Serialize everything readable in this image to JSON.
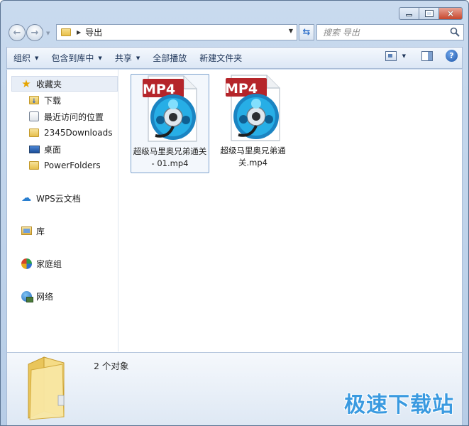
{
  "window": {
    "caption_buttons": {
      "minimize": "minimize",
      "maximize": "maximize",
      "close": "×"
    }
  },
  "address_bar": {
    "path": "导出",
    "icons": [
      "back-arrow-icon",
      "forward-arrow-icon",
      "folder-icon",
      "breadcrumb-separator-icon",
      "dropdown-icon",
      "refresh-icon"
    ]
  },
  "search": {
    "placeholder": "搜索 导出"
  },
  "toolbar": {
    "organize": "组织",
    "include_in_library": "包含到库中",
    "share": "共享",
    "play_all": "全部播放",
    "new_folder": "新建文件夹",
    "help": "?"
  },
  "sidebar": {
    "favorites": "收藏夹",
    "items": [
      {
        "label": "下载",
        "icon": "download-folder-icon"
      },
      {
        "label": "最近访问的位置",
        "icon": "recent-places-icon"
      },
      {
        "label": "2345Downloads",
        "icon": "folder-icon"
      },
      {
        "label": "桌面",
        "icon": "desktop-icon"
      },
      {
        "label": "PowerFolders",
        "icon": "folder-icon"
      }
    ],
    "wps_cloud": "WPS云文档",
    "libraries": "库",
    "homegroup": "家庭组",
    "network": "网络"
  },
  "files": [
    {
      "name": "超级马里奥兄弟通关 - 01.mp4",
      "badge": "MP4",
      "selected": true
    },
    {
      "name": "超级马里奥兄弟通关.mp4",
      "badge": "MP4",
      "selected": false
    }
  ],
  "details": {
    "count_text": "2 个对象"
  },
  "watermark": {
    "text": "极速下载站"
  },
  "colors": {
    "mp4_badge": "#b5252a",
    "reel_blue": "#1f9fd6",
    "watermark": "#3a9ae0"
  }
}
